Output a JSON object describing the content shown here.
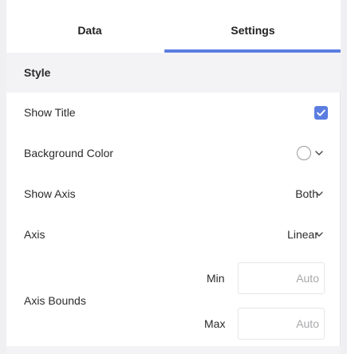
{
  "tabs": [
    {
      "label": "Data",
      "active": false
    },
    {
      "label": "Settings",
      "active": true
    }
  ],
  "section": {
    "title": "Style"
  },
  "rows": {
    "show_title": {
      "label": "Show Title",
      "checked": true
    },
    "background_color": {
      "label": "Background Color",
      "value": "#ffffff"
    },
    "show_axis": {
      "label": "Show Axis",
      "value": "Both"
    },
    "axis": {
      "label": "Axis",
      "value": "Linear"
    },
    "axis_bounds": {
      "label": "Axis Bounds",
      "min_label": "Min",
      "min_placeholder": "Auto",
      "max_label": "Max",
      "max_placeholder": "Auto"
    }
  },
  "colors": {
    "accent": "#5b7de0",
    "section_bg": "#f3f3f5",
    "text": "#2b2b2b",
    "placeholder": "#a8a8ac"
  },
  "icons": {
    "checkbox": "check-icon",
    "dropdown": "chevron-down-icon"
  }
}
